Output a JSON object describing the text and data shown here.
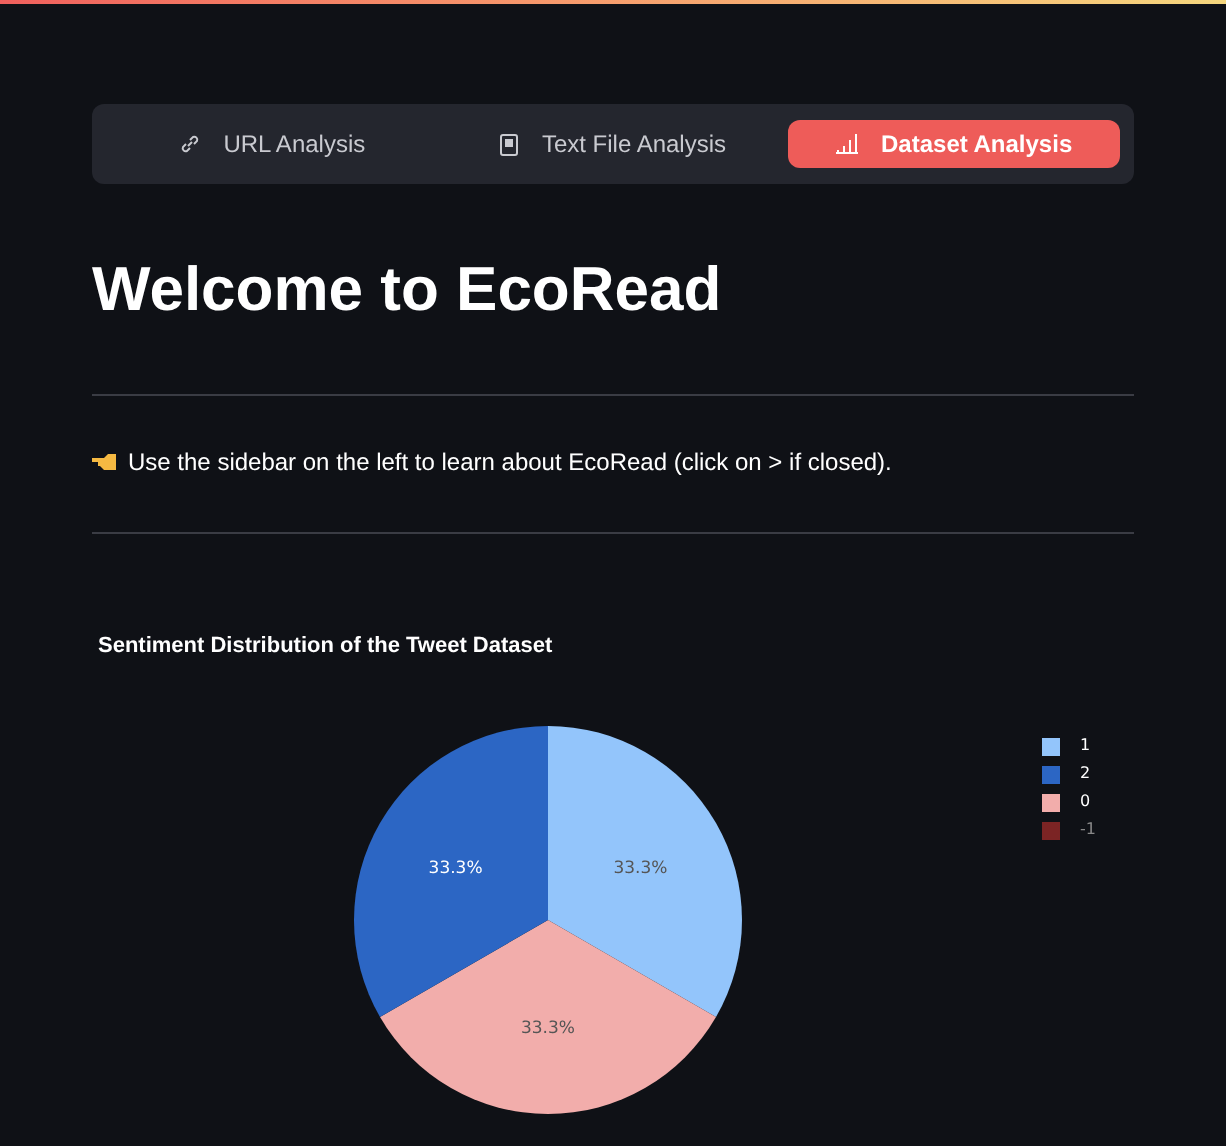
{
  "tabs": [
    {
      "label": "URL Analysis",
      "kind": "link",
      "selected": false
    },
    {
      "label": "Text File Analysis",
      "kind": "file",
      "selected": false
    },
    {
      "label": "Dataset Analysis",
      "kind": "chart",
      "selected": true
    }
  ],
  "title": "Welcome to EcoRead",
  "intro": "Use the sidebar on the left to learn about EcoRead (click on > if closed).",
  "chart_data": {
    "type": "pie",
    "title": "Sentiment Distribution of the Tweet Dataset",
    "categories": [
      "1",
      "2",
      "0",
      "-1"
    ],
    "legend": "right",
    "series": [
      {
        "colors": [
          "#93c5fb",
          "#2c66c4",
          "#f2adab",
          "#7b2424"
        ],
        "values": [
          1,
          1,
          1,
          0
        ]
      }
    ],
    "value_labels": [
      "33.3%",
      "33.3%",
      "33.3%"
    ]
  }
}
